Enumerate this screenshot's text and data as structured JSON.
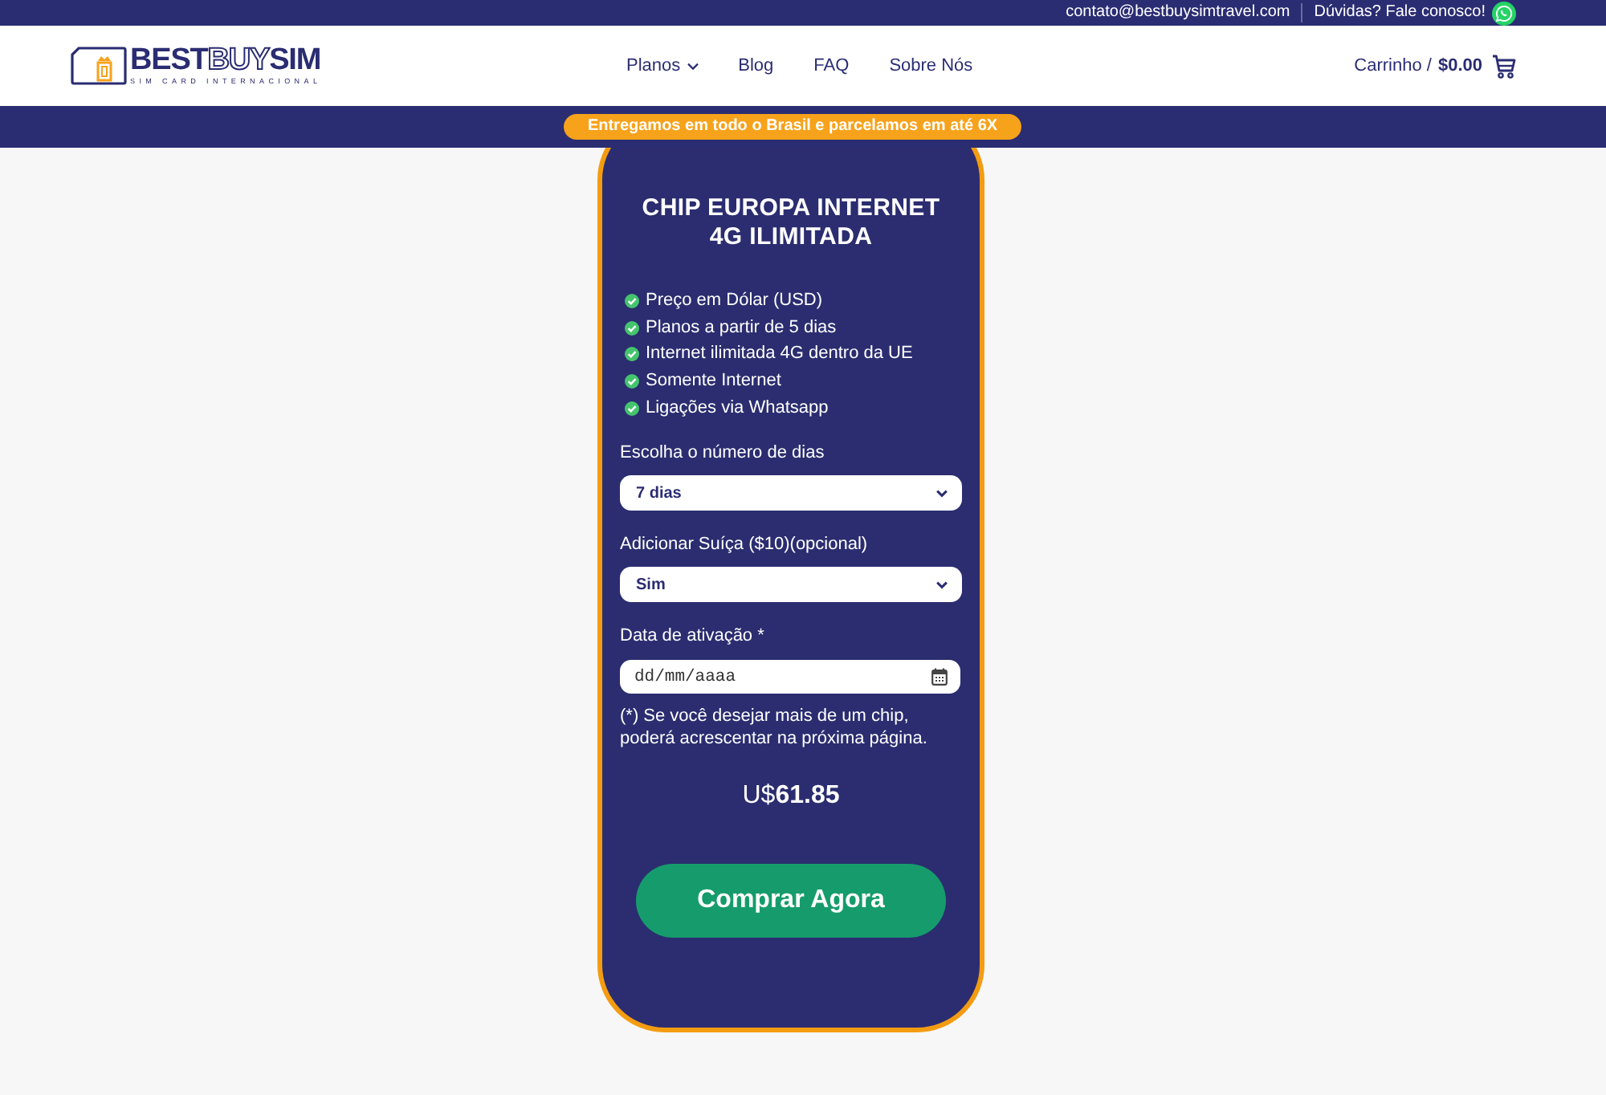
{
  "top_bar": {
    "email": "contato@bestbuysimtravel.com",
    "contact_label": "Dúvidas? Fale conosco!"
  },
  "header": {
    "logo": {
      "wordmark": [
        {
          "text": "BEST",
          "kind": "solid"
        },
        {
          "text": "BUY",
          "kind": "outline"
        },
        {
          "text": "SIM",
          "kind": "solid"
        }
      ],
      "tagline": "SIM CARD INTERNACIONAL"
    },
    "nav": [
      {
        "label": "Planos",
        "kind": "dropdown"
      },
      {
        "label": "Blog",
        "kind": "link"
      },
      {
        "label": "FAQ",
        "kind": "link"
      },
      {
        "label": "Sobre Nós",
        "kind": "link"
      }
    ],
    "cart": {
      "label": "Carrinho /",
      "total": "$0.00"
    }
  },
  "banner": "Entregamos em todo o Brasil e parcelamos em até 6X",
  "product": {
    "title_lines": [
      "CHIP EUROPA INTERNET",
      "4G ILIMITADA"
    ],
    "features": [
      "Preço em Dólar (USD)",
      "Planos a partir de 5 dias",
      "Internet ilimitada 4G dentro da UE",
      "Somente Internet",
      "Ligações via Whatsapp"
    ],
    "fields": [
      {
        "kind": "select",
        "label": "Escolha o número de dias",
        "value": "7 dias"
      },
      {
        "kind": "select",
        "label": "Adicionar Suíça ($10)(opcional)",
        "value": "Sim"
      },
      {
        "kind": "date",
        "label": "Data de ativação *",
        "placeholder": "dd/mm/aaaa"
      }
    ],
    "note": "(*) Se você desejar mais de um chip, poderá acrescentar na próxima página.",
    "price": "U$**61.85**",
    "buy_button": "Comprar Agora"
  }
}
